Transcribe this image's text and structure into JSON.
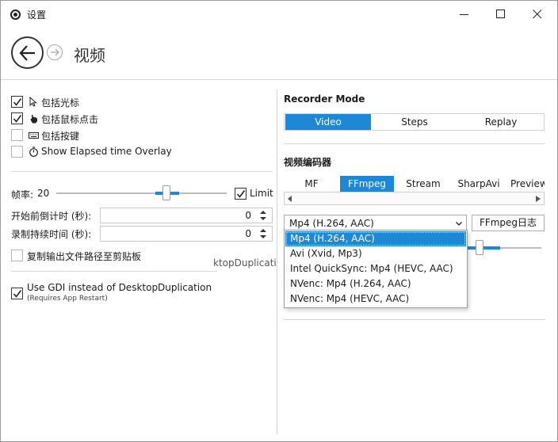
{
  "window": {
    "title": "设置",
    "page_title": "视频"
  },
  "left": {
    "options": [
      {
        "label": "包括光标",
        "checked": true,
        "icon": "cursor-icon"
      },
      {
        "label": "包括鼠标点击",
        "checked": true,
        "icon": "hand-icon"
      },
      {
        "label": "包括按键",
        "checked": false,
        "icon": "keyboard-icon"
      },
      {
        "label": "Show Elapsed time Overlay",
        "checked": false,
        "icon": "stopwatch-icon"
      }
    ],
    "fps": {
      "label": "帧率:",
      "value": "20",
      "limit_label": "Limit",
      "limit_checked": true
    },
    "countdown": {
      "label": "开始前倒计时 (秒):",
      "value": "0"
    },
    "duration": {
      "label": "录制持续时间 (秒):",
      "value": "0"
    },
    "copy_path": {
      "label": "复制输出文件路径至剪贴板",
      "checked": false
    },
    "gdi": {
      "label": "Use GDI instead of DesktopDuplication",
      "note": "(Requires App Restart)",
      "checked": true
    },
    "ghost_text": "ktopDuplication"
  },
  "right": {
    "recorder_mode": {
      "heading": "Recorder Mode",
      "options": [
        "Video",
        "Steps",
        "Replay"
      ],
      "selected": "Video"
    },
    "encoder": {
      "heading": "视频编码器",
      "tabs": [
        "MF",
        "FFmpeg",
        "Stream",
        "SharpAvi",
        "Preview"
      ],
      "selected": "FFmpeg",
      "combo_value": "Mp4 (H.264, AAC)",
      "log_button": "FFmpeg日志",
      "dropdown": [
        "Mp4 (H.264, AAC)",
        "Avi (Xvid, Mp3)",
        "Intel QuickSync: Mp4 (HEVC, AAC)",
        "NVenc: Mp4 (H.264, AAC)",
        "NVenc: Mp4 (HEVC, AAC)"
      ]
    }
  },
  "colors": {
    "accent": "#1e88d6"
  }
}
